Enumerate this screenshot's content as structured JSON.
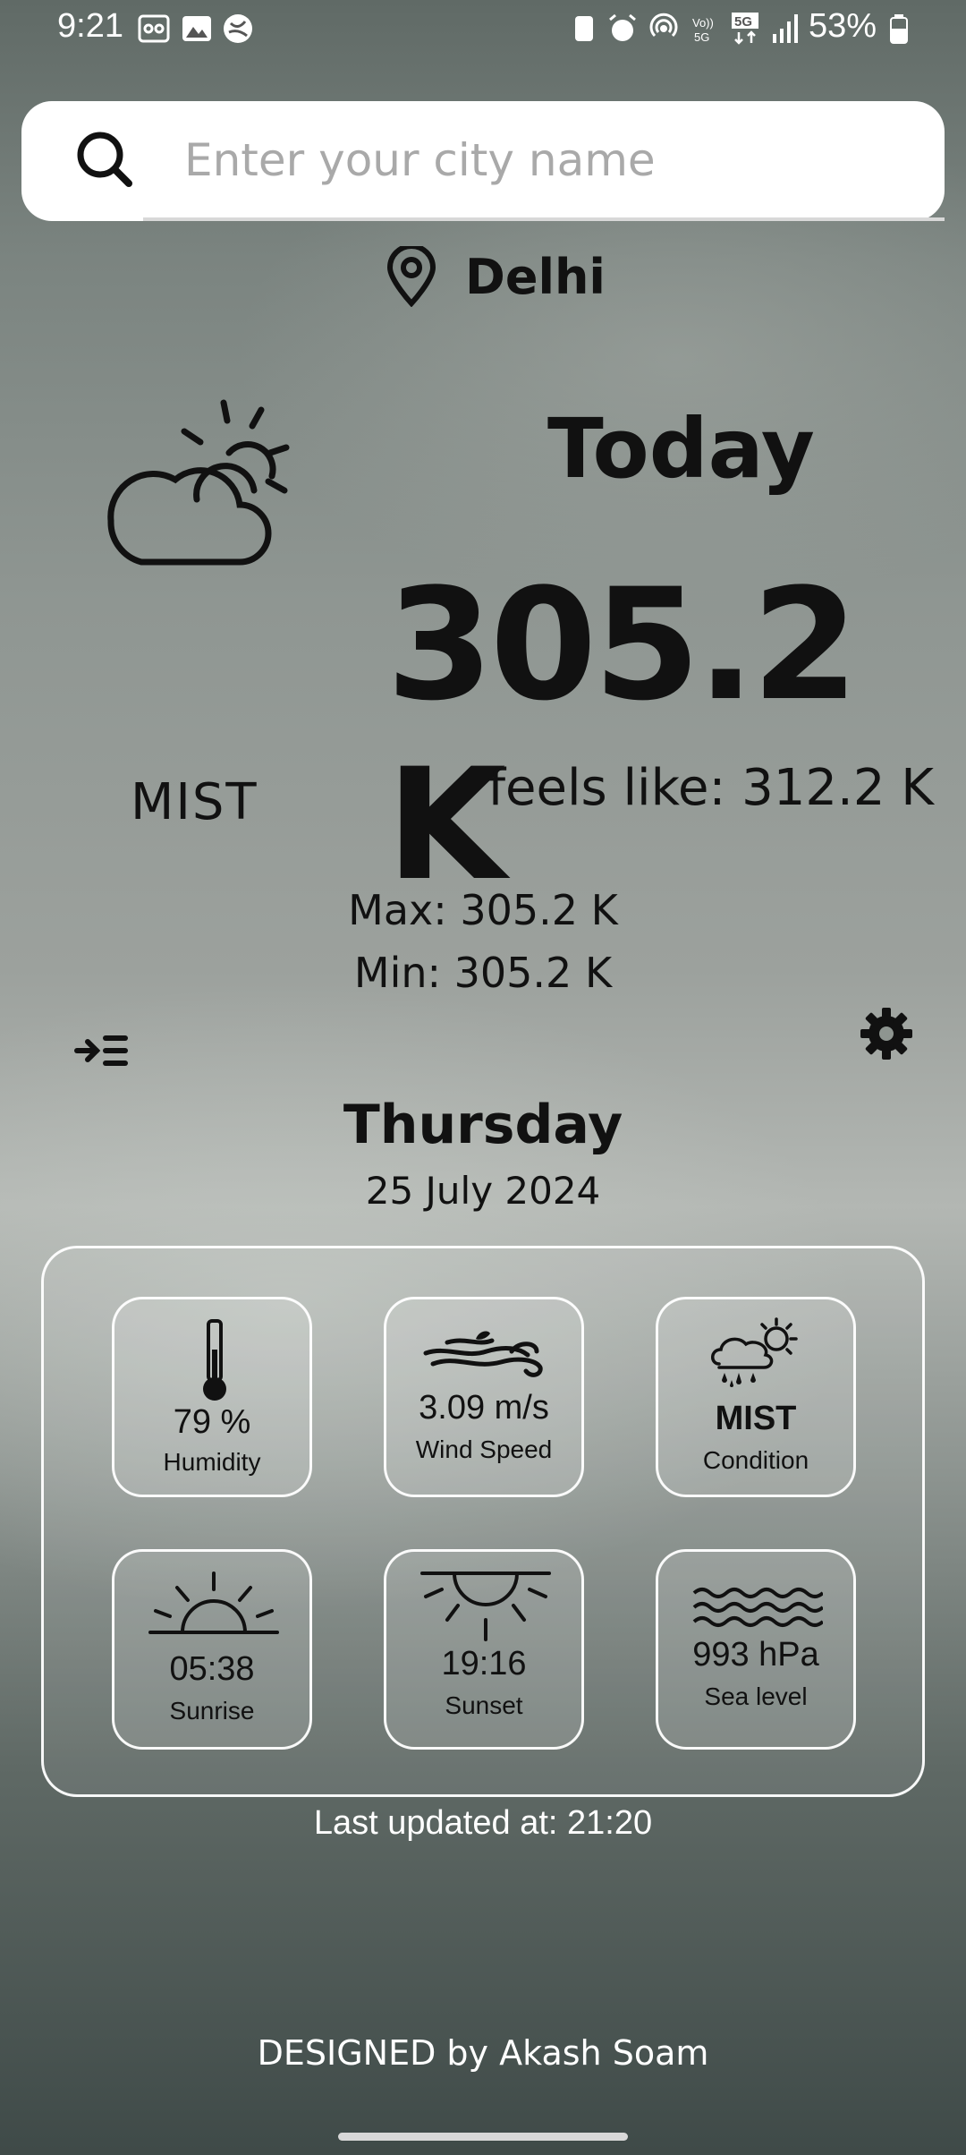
{
  "status_bar": {
    "time": "9:21",
    "battery": "53%",
    "network": "5G"
  },
  "search": {
    "placeholder": "Enter your city name",
    "value": ""
  },
  "location": {
    "city": "Delhi"
  },
  "today": {
    "heading": "Today",
    "temperature": "305.2 K",
    "feels_like": "feels like: 312.2 K",
    "condition": "MIST",
    "max": "Max: 305.2 K",
    "min": "Min: 305.2 K",
    "day": "Thursday",
    "date": "25 July 2024"
  },
  "details": {
    "humidity": {
      "value": "79 %",
      "label": "Humidity",
      "icon": "thermometer-icon"
    },
    "wind": {
      "value": "3.09 m/s",
      "label": "Wind Speed",
      "icon": "wind-icon"
    },
    "condition": {
      "value": "MIST",
      "label": "Condition",
      "icon": "cloud-rain-sun-icon"
    },
    "sunrise": {
      "value": "05:38",
      "label": "Sunrise",
      "icon": "sunrise-icon"
    },
    "sunset": {
      "value": "19:16",
      "label": "Sunset",
      "icon": "sunset-icon"
    },
    "sea_level": {
      "value": "993 hPa",
      "label": "Sea level",
      "icon": "waves-icon"
    }
  },
  "last_updated": "Last updated at: 21:20",
  "footer": "DESIGNED by Akash Soam",
  "colors": {
    "text": "#111111",
    "card_border": "#ffffff",
    "search_bg": "#ffffff"
  }
}
